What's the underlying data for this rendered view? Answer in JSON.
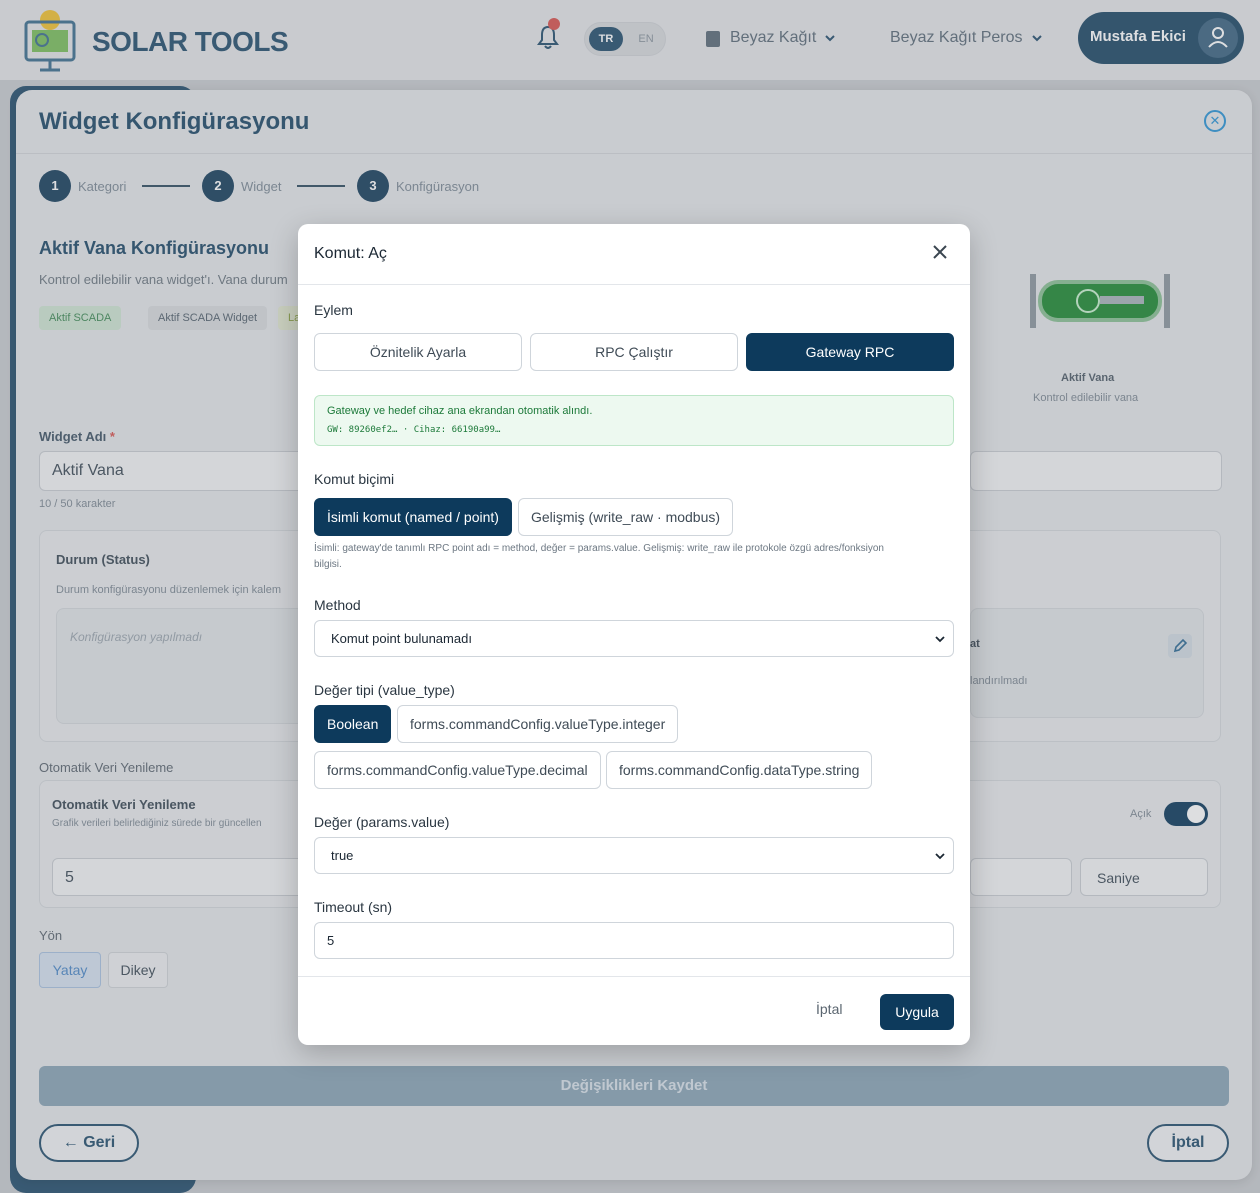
{
  "topbar": {
    "brand": "SOLAR TOOLS",
    "lang_active": "TR",
    "lang_other": "EN",
    "company_select": "Beyaz Kağıt",
    "site_select": "Beyaz Kağıt Peros",
    "user_name": "Mustafa Ekici"
  },
  "page": {
    "title": "Widget Konfigürasyonu",
    "steps": [
      {
        "num": "1",
        "label": "Kategori"
      },
      {
        "num": "2",
        "label": "Widget"
      },
      {
        "num": "3",
        "label": "Konfigürasyon"
      }
    ],
    "section_title": "Aktif Vana Konfigürasyonu",
    "section_desc": "Kontrol edilebilir vana widget'ı. Vana durum",
    "tags": [
      "Aktif SCADA",
      "Aktif SCADA Widget",
      "La"
    ],
    "preview_name": "Aktif Vana",
    "preview_desc": "Kontrol edilebilir vana",
    "widget_name_label": "Widget Adı",
    "widget_name_value": "Aktif Vana",
    "widget_name_counter": "10 / 50 karakter",
    "status_title": "Durum (Status)",
    "status_desc": "Durum konfigürasyonu düzenlemek için kalem",
    "status_empty": "Konfigürasyon yapılmadı",
    "right_card_title": "at",
    "right_card_desc": "landırılmadı",
    "auto_refresh_label": "Otomatik Veri Yenileme",
    "auto_refresh_title": "Otomatik Veri Yenileme",
    "auto_refresh_desc": "Grafik verileri belirlediğiniz sürede bir güncellen",
    "auto_refresh_state": "Açık",
    "refresh_value": "5",
    "refresh_unit": "Saniye",
    "direction_label": "Yön",
    "direction_options": [
      "Yatay",
      "Dikey"
    ],
    "save_button": "Değişiklikleri Kaydet",
    "back_button": "← Geri",
    "cancel_button": "İptal"
  },
  "modal": {
    "title": "Komut: Aç",
    "action_label": "Eylem",
    "actions": [
      "Öznitelik Ayarla",
      "RPC Çalıştır",
      "Gateway RPC"
    ],
    "info_main": "Gateway ve hedef cihaz ana ekrandan otomatik alındı.",
    "info_code": "GW: 89260ef2… · Cihaz: 66190a99…",
    "format_label": "Komut biçimi",
    "formats": [
      "İsimli komut (named / point)",
      "Gelişmiş (write_raw · modbus)"
    ],
    "format_help": "İsimli: gateway'de tanımlı RPC point adı = method, değer = params.value. Gelişmiş: write_raw ile protokole özgü adres/fonksiyon bilgisi.",
    "method_label": "Method",
    "method_value": "Komut point bulunamadı",
    "value_type_label": "Değer tipi (value_type)",
    "value_types": [
      "Boolean",
      "forms.commandConfig.valueType.integer",
      "forms.commandConfig.valueType.decimal",
      "forms.commandConfig.dataType.string"
    ],
    "value_label": "Değer (params.value)",
    "value_value": "true",
    "timeout_label": "Timeout (sn)",
    "timeout_value": "5",
    "cancel": "İptal",
    "apply": "Uygula"
  }
}
